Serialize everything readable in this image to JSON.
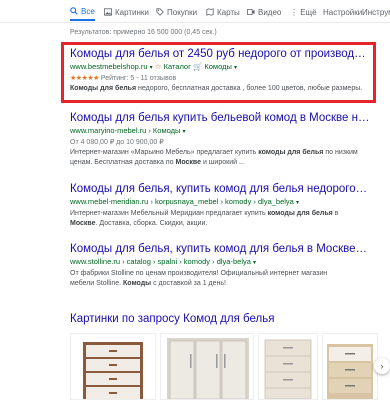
{
  "tabs": [
    {
      "label": "Все",
      "icon": "search-icon",
      "active": true
    },
    {
      "label": "Картинки",
      "icon": "image-icon"
    },
    {
      "label": "Покупки",
      "icon": "tag-icon"
    },
    {
      "label": "Карты",
      "icon": "map-icon"
    },
    {
      "label": "Видео",
      "icon": "video-icon"
    },
    {
      "label": "⋮ Ещё"
    },
    {
      "label": "Настройки"
    },
    {
      "label": "Инструм"
    }
  ],
  "stats": "Результатов: примерно 16 500 000 (0,45 сек.)",
  "results": [
    {
      "title": "Комоды для белья от 2450 руб недорого от производителя в ...",
      "url": "www.bestmebelshop.ru",
      "url_extra1": "Каталог",
      "url_extra2": "Комоды",
      "rating_stars": "★★★★★",
      "rating_text": "Рейтинг: 5 - 11 отзывов",
      "snippet_bold": "Комоды для белья",
      "snippet": " недорого, бесплатная доставка , более 100 цветов, любые размеры."
    },
    {
      "title": "Комоды для белья купить бельевой комод в Москве недорого ...",
      "url": "www.maryino-mebel.ru › Комоды",
      "meta": "От 4 080,00 ₽ до 10 900,00 ₽",
      "snippet1a": "Интернет-магазин «Марьино Мебель» предлагает купить ",
      "snippet1b": "комоды для белья",
      "snippet1c": " по низким",
      "snippet2a": "ценам. Бесплатная доставка по ",
      "snippet2b": "Москве",
      "snippet2c": " и широкий ..."
    },
    {
      "title": "Комоды для белья, купить комод для белья недорого в интер...",
      "url": "www.mebel-meridian.ru › korpusnaya_mebel › komody › dlya_belya",
      "snippet1a": "Интернет-магазин Мебельный Меридиан предлагает купить ",
      "snippet1b": "комоды для белья",
      "snippet1c": " в",
      "snippet2a": "Москве",
      "snippet2b": ". Доставка, сборка. Скидки, акции."
    },
    {
      "title": "Комоды для белья, купить комод для белья в Москве ... - Stolli...",
      "url": "www.stolline.ru › catalog › spalni › komody › dlya-belya",
      "snippet1": "От фабрики Stolline по ценам производителя! Официальный интернет магазин",
      "snippet2a": "мебели Stolline. ",
      "snippet2b": "Комоды",
      "snippet2c": " с доставкой за 1 день!"
    }
  ],
  "images_heading": "Картинки по запросу Комод для белья",
  "colors": {
    "link": "#1a0dab",
    "url": "#006621",
    "highlight": "#e6242b",
    "accent": "#1a73e8"
  }
}
